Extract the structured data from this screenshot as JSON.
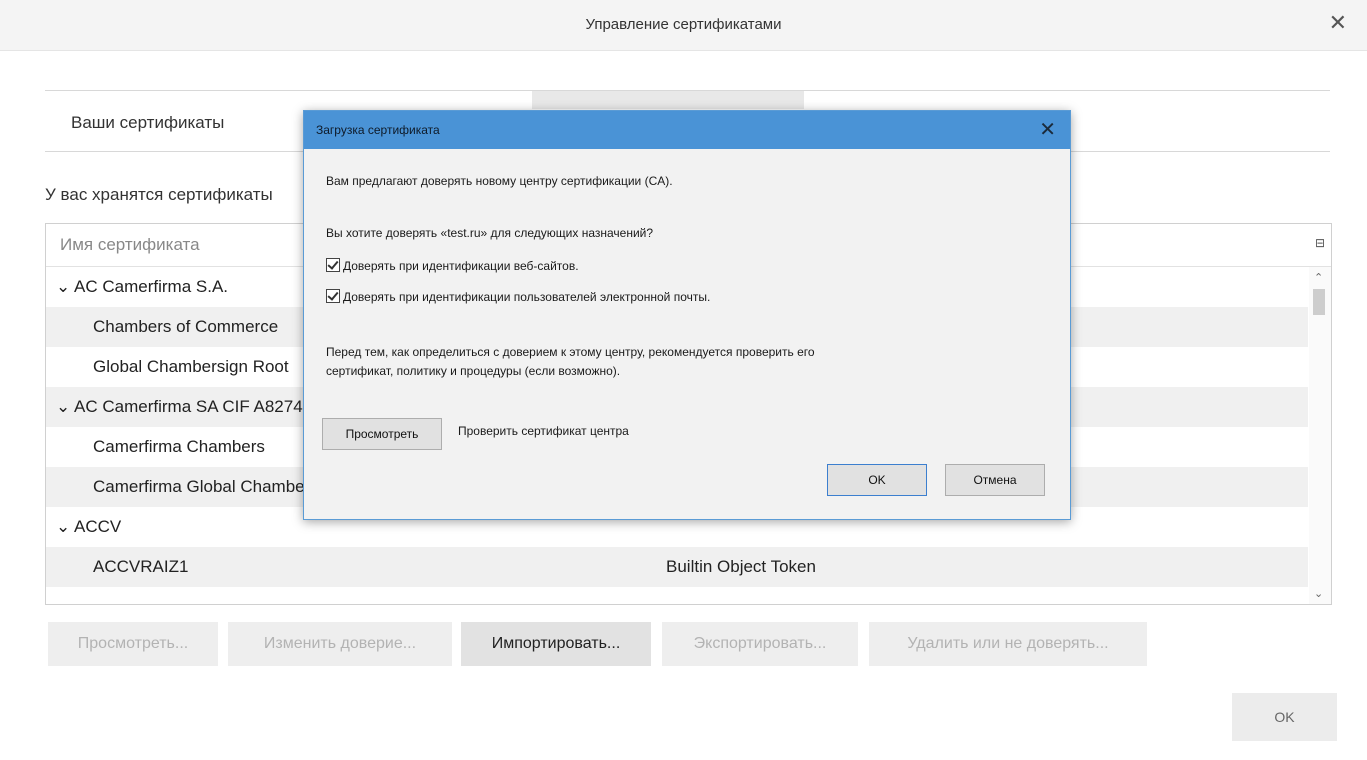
{
  "window": {
    "title": "Управление сертификатами",
    "close_glyph": "✕"
  },
  "tabs": {
    "your_certificates": "Ваши сертификаты"
  },
  "stored_text": "У вас хранятся сертификаты",
  "tree": {
    "column_name": "Имя сертификата",
    "picker_glyph": "⊟",
    "rows": [
      {
        "name": "⌄ AC Camerfirma S.A.",
        "token": "",
        "level": "group"
      },
      {
        "name": "Chambers of Commerce",
        "token": "",
        "level": "child"
      },
      {
        "name": "Global Chambersign Root",
        "token": "",
        "level": "child"
      },
      {
        "name": "⌄ AC Camerfirma SA CIF A82743287",
        "token": "",
        "level": "group"
      },
      {
        "name": "Camerfirma Chambers",
        "token": "",
        "level": "child"
      },
      {
        "name": "Camerfirma Global Chambersign",
        "token": "",
        "level": "child"
      },
      {
        "name": "⌄ ACCV",
        "token": "",
        "level": "group"
      },
      {
        "name": "ACCVRAIZ1",
        "token": "Builtin Object Token",
        "level": "child"
      }
    ]
  },
  "buttons": {
    "view": "Просмотреть...",
    "edit_trust": "Изменить доверие...",
    "import": "Импортировать...",
    "export": "Экспортировать...",
    "delete": "Удалить или не доверять...",
    "ok": "OK"
  },
  "dialog": {
    "title": "Загрузка сертификата",
    "close_glyph": "✕",
    "line1": "Вам предлагают доверять новому центру сертификации (CA).",
    "question": "Вы хотите доверять «test.ru» для следующих назначений?",
    "check_websites": "Доверять при идентификации веб-сайтов.",
    "check_email": "Доверять при идентификации пользователей электронной почты.",
    "advice1": "Перед тем, как определиться с доверием к этому центру, рекомендуется проверить его",
    "advice2": "сертификат, политику и процедуры (если возможно).",
    "view_button": "Просмотреть",
    "view_label": "Проверить сертификат центра",
    "ok_button": "OK",
    "cancel_button": "Отмена"
  }
}
